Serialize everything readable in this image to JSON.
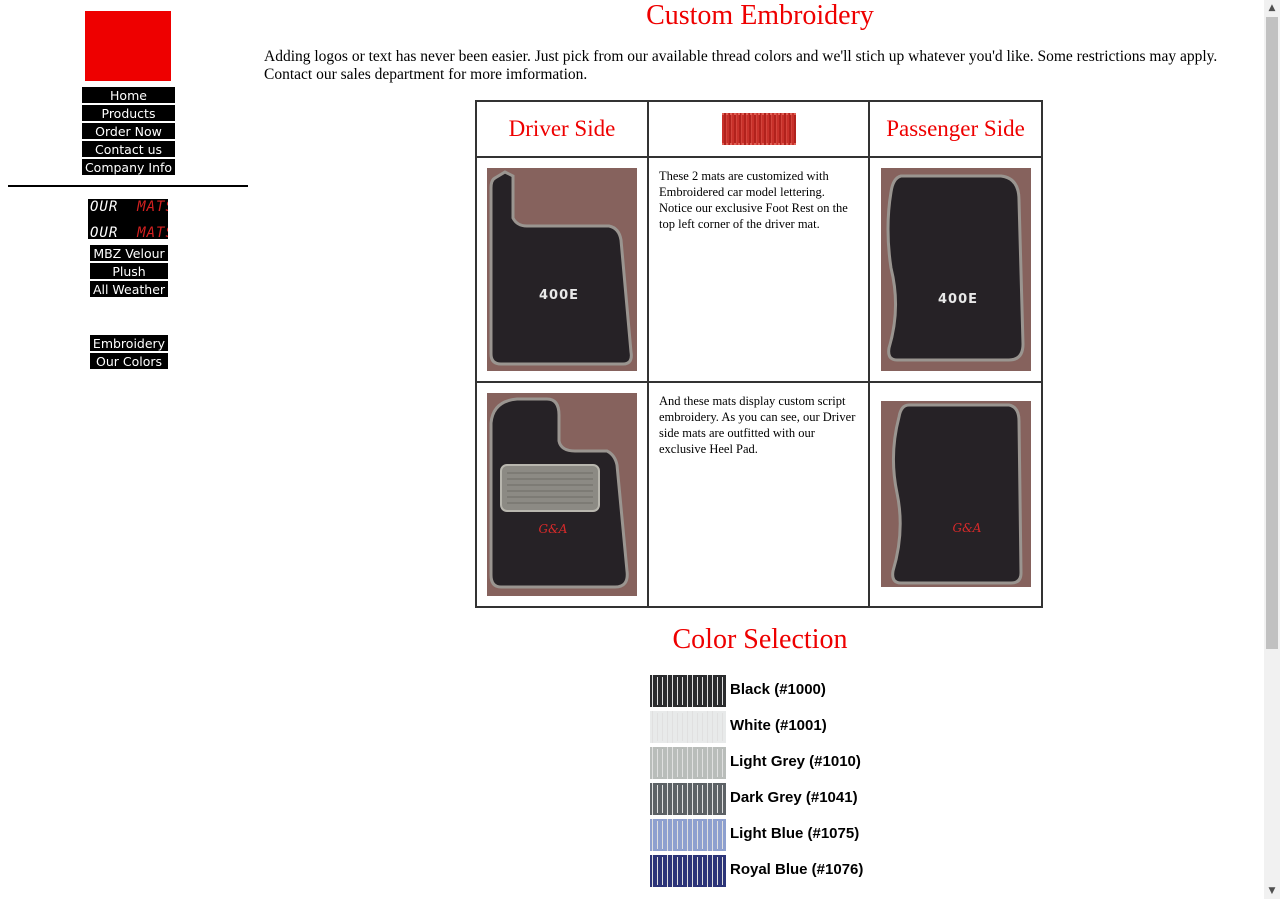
{
  "sidebar": {
    "nav": [
      "Home",
      "Products",
      "Order Now",
      "Contact us",
      "Company Info"
    ],
    "brand_logo_text": [
      "OUR",
      "MATS",
      "OUR",
      "MATS"
    ],
    "product_nav": [
      "MBZ Velour",
      "Plush",
      "All Weather"
    ],
    "extra_nav": [
      "Embroidery",
      "Our Colors"
    ]
  },
  "main": {
    "title": "Custom Embroidery",
    "intro": "Adding logos or text has never been easier.  Just pick from our available thread colors and we'll stich up whatever you'd like.  Some restrictions may apply.   Contact our sales department for more imformation.",
    "table": {
      "driver_header": "Driver Side",
      "passenger_header": "Passenger Side",
      "row1_text": "These 2 mats are customized with Embroidered car model lettering. Notice our exclusive Foot Rest on the top left corner of the driver mat.",
      "row1_mat_lettering": "400E",
      "row2_text": "And these mats display custom script embroidery. As you can see, our Driver side mats are outfitted with our exclusive Heel Pad.",
      "row2_mat_lettering": "G&A"
    },
    "color_title": "Color Selection",
    "colors": [
      {
        "label": "Black (#1000)",
        "hex": "#2a2b2d"
      },
      {
        "label": "White (#1001)",
        "hex": "#e8eaea"
      },
      {
        "label": "Light Grey (#1010)",
        "hex": "#b9bdba"
      },
      {
        "label": "Dark Grey (#1041)",
        "hex": "#5d6266"
      },
      {
        "label": "Light Blue (#1075)",
        "hex": "#8ea0cf"
      },
      {
        "label": "Royal Blue (#1076)",
        "hex": "#2c3478"
      }
    ]
  },
  "theme": {
    "accent": "#ee0000",
    "nav_bg": "#000000",
    "mat_backdrop": "#86625d",
    "mat_color": "#262226"
  }
}
